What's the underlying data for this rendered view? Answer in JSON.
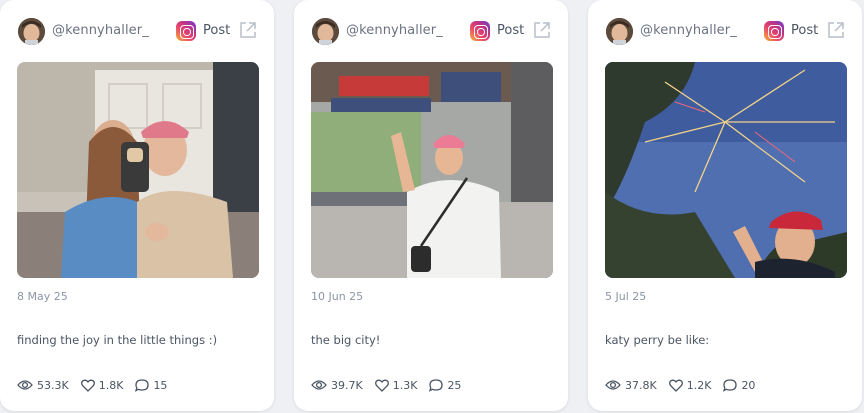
{
  "posts": [
    {
      "username": "@kennyhaller_",
      "platform_icon": "instagram-icon",
      "post_label": "Post",
      "date": "8 May 25",
      "caption": "finding the joy in the little things :)",
      "views": "53.3K",
      "likes": "1.8K",
      "comments": "15"
    },
    {
      "username": "@kennyhaller_",
      "platform_icon": "instagram-icon",
      "post_label": "Post",
      "date": "10 Jun 25",
      "caption": "the big city!",
      "views": "39.7K",
      "likes": "1.3K",
      "comments": "25"
    },
    {
      "username": "@kennyhaller_",
      "platform_icon": "instagram-icon",
      "post_label": "Post",
      "date": "5 Jul 25",
      "caption": "katy perry be like:",
      "views": "37.8K",
      "likes": "1.2K",
      "comments": "20"
    }
  ],
  "colors": {
    "background": "#eef0f4",
    "card": "#ffffff",
    "muted_text": "#8b95a5",
    "body_text": "#4b5563"
  }
}
